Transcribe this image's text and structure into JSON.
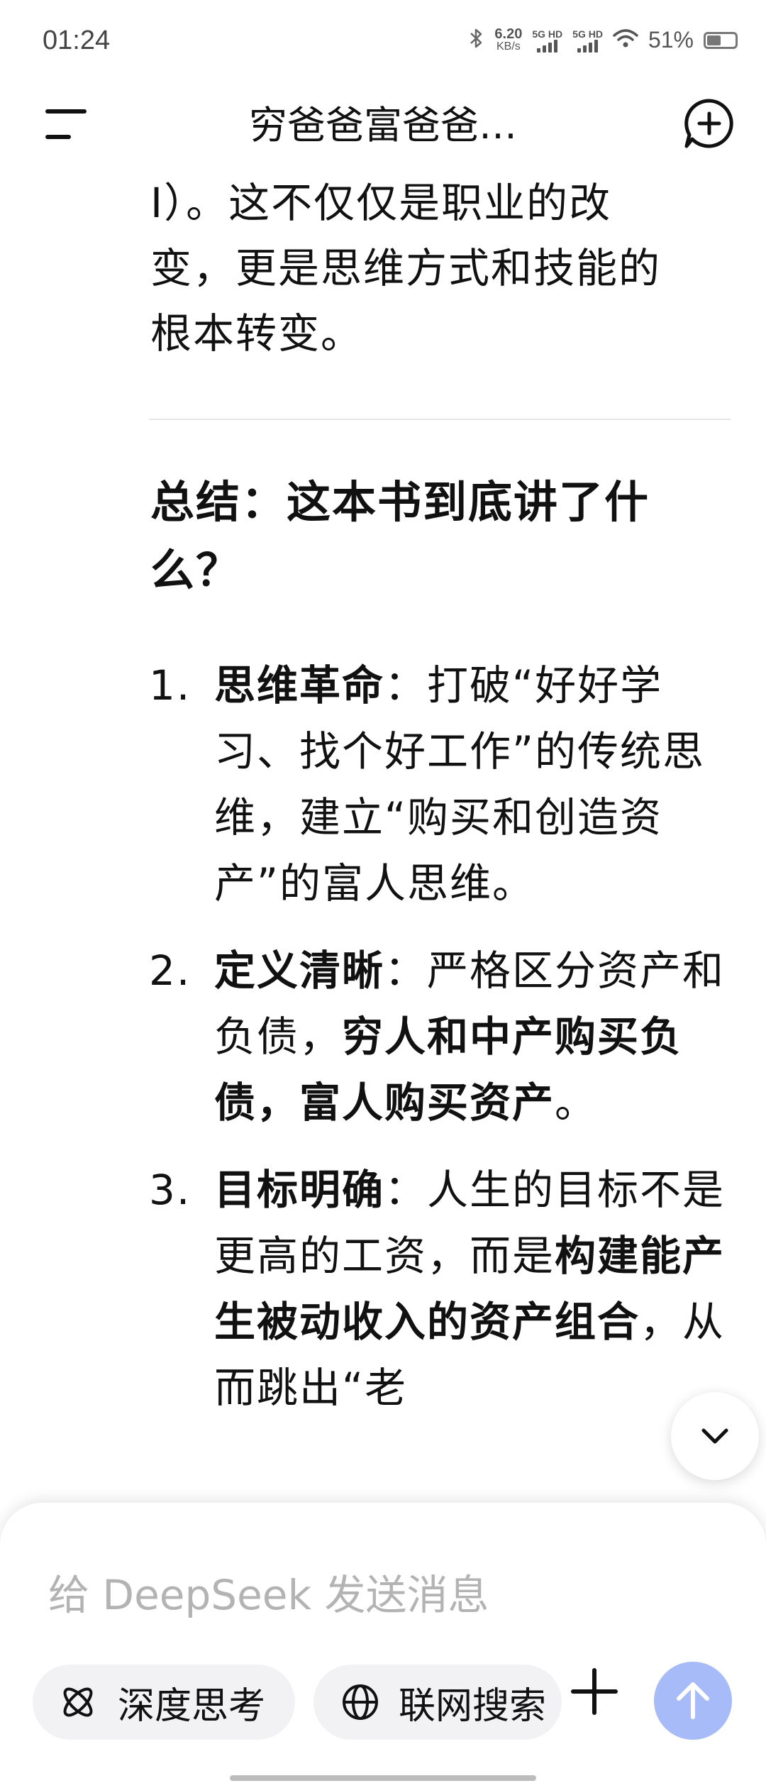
{
  "status_bar": {
    "time": "01:24",
    "net_speed_value": "6.20",
    "net_speed_unit": "KB/s",
    "signal1_label": "5G HD",
    "signal2_label": "5G HD",
    "battery_percent": "51%",
    "battery_level": 0.51
  },
  "header": {
    "title": "穷爸爸富爸爸…"
  },
  "content": {
    "para_lines": [
      "I）。这不仅仅是职业的改",
      "变，更是思维方式和技能的",
      "根本转变。"
    ],
    "heading": "总结：这本书到底讲了什么？",
    "list": [
      {
        "num": "1.",
        "bold": "思维革命",
        "text1": "：打破“好好学习、找个好工作”的传统思维，建立“购买和创造资产”的富人思维。"
      },
      {
        "num": "2.",
        "bold": "定义清晰",
        "text1": "：严格区分资产和负债，",
        "bold2": "穷人和中产购买负债，富人购买资产",
        "text2": "。"
      },
      {
        "num": "3.",
        "bold": "目标明确",
        "text1": "：人生的目标不是更高的工资，而是",
        "bold2": "构建能产生被动收入的资产组合",
        "text2": "，从而跳出“老"
      }
    ]
  },
  "composer": {
    "placeholder": "给 DeepSeek 发送消息",
    "deep_think_label": "深度思考",
    "web_search_label": "联网搜索"
  },
  "colors": {
    "send_button": "#a6bbf7",
    "chip_bg": "#f2f2f4"
  }
}
